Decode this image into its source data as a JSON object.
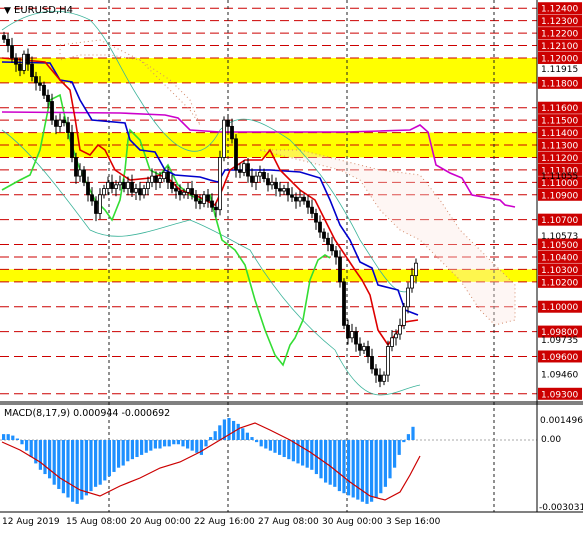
{
  "window": {
    "symbol_label": "EURUSD,H4",
    "menu_glyph": "▼"
  },
  "macd": {
    "label": "MACD(8,17,9) 0.000944 -0.000692",
    "scale_labels": [
      "0.001496",
      "0.00",
      "-0.003031"
    ]
  },
  "price_axis": {
    "plain_labels": [
      "1.11915",
      "1.11055",
      "1.10573",
      "1.10573",
      "1.09735",
      "1.09460"
    ],
    "boxed_labels": [
      "1.12400",
      "1.12300",
      "1.12200",
      "1.12100",
      "1.12000",
      "1.11800",
      "1.11600",
      "1.11500",
      "1.11400",
      "1.11300",
      "1.11200",
      "1.11100",
      "1.11000",
      "1.10900",
      "1.10700",
      "1.10500",
      "1.10400",
      "1.10300",
      "1.10200",
      "1.10000",
      "1.09800",
      "1.09600",
      "1.09300"
    ]
  },
  "time_axis": {
    "labels": [
      "12 Aug 2019",
      "15 Aug 08:00",
      "20 Aug 00:00",
      "22 Aug 16:00",
      "27 Aug 08:00",
      "30 Aug 00:00",
      "3 Sep 16:00"
    ]
  },
  "chart_data": {
    "type": "candlestick",
    "symbol": "EURUSD",
    "timeframe": "H4",
    "price_range": [
      1.0925,
      1.1245
    ],
    "zones": [
      {
        "from": 1.118,
        "to": 1.12,
        "color": "#ffff00"
      },
      {
        "from": 1.112,
        "to": 1.114,
        "color": "#ffff00"
      },
      {
        "from": 1.102,
        "to": 1.103,
        "color": "#ffff00"
      }
    ],
    "levels": [
      1.124,
      1.123,
      1.122,
      1.121,
      1.12,
      1.118,
      1.116,
      1.115,
      1.114,
      1.113,
      1.112,
      1.111,
      1.11,
      1.109,
      1.107,
      1.105,
      1.104,
      1.103,
      1.102,
      1.1,
      1.098,
      1.096,
      1.093
    ],
    "indicators": {
      "ichimoku": true,
      "bollinger": true,
      "macd": {
        "fast": 8,
        "slow": 17,
        "signal": 9,
        "value": 0.000944,
        "signal_value": -0.000692,
        "range": [
          -0.003031,
          0.001496
        ]
      }
    },
    "colors": {
      "level_line": "#cc0000",
      "label_box": "#cc0000",
      "zone": "#ffff00",
      "macd_histogram": "#1e90ff",
      "macd_signal": "#cc0000",
      "kijun": "#0000cc",
      "tenkan": "#dd0000",
      "chikou": "#33dd33",
      "senkou": "#cc00cc"
    }
  }
}
